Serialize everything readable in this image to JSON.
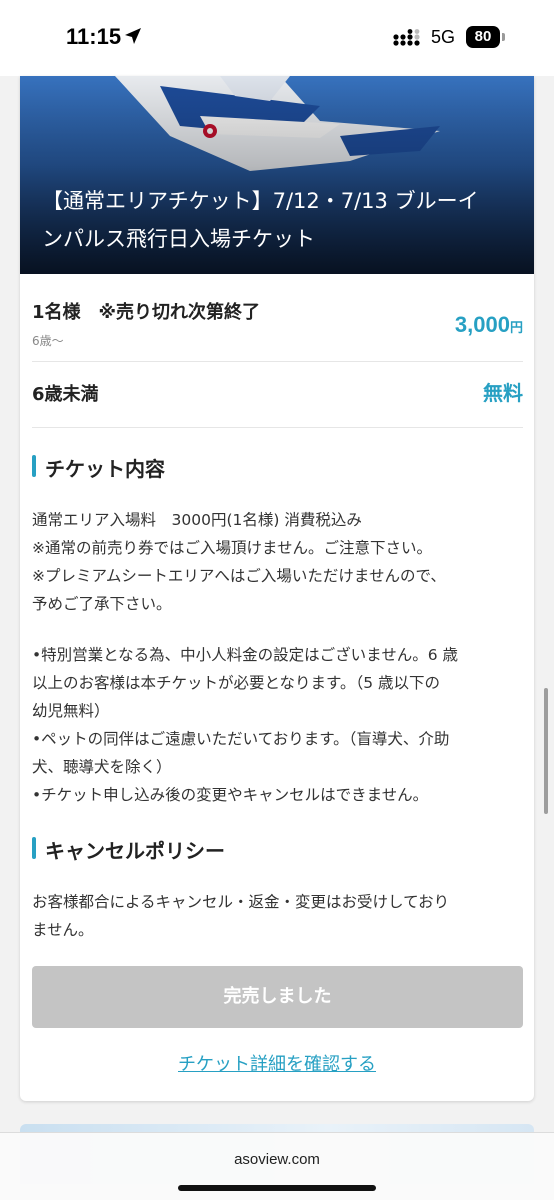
{
  "status_bar": {
    "time": "11:15",
    "network": "5G",
    "battery": "80"
  },
  "hero": {
    "title_line1": "【通常エリアチケット】7/12・7/13 ブルーイ",
    "title_line2": "ンパルス飛行日入場チケット"
  },
  "prices": [
    {
      "label": "1名様　※売り切れ次第終了",
      "sub": "6歳〜",
      "amount": "3,000",
      "unit": "円"
    },
    {
      "label": "6歳未満",
      "amount": "無料"
    }
  ],
  "ticket_section": {
    "heading": "チケット内容",
    "block1": [
      "通常エリア入場料　3000円(1名様) 消費税込み",
      "※通常の前売り券ではご入場頂けません。ご注意下さい。",
      "※プレミアムシートエリアへはご入場いただけませんので、",
      "予めご了承下さい。"
    ],
    "block2": [
      "•特別営業となる為、中小人料金の設定はございません。6 歳",
      "以上のお客様は本チケットが必要となります。（5 歳以下の",
      "幼児無料）",
      "•ペットの同伴はご遠慮いただいております。（盲導犬、介助",
      "犬、聴導犬を除く）",
      "•チケット申し込み後の変更やキャンセルはできません。"
    ]
  },
  "cancel_section": {
    "heading": "キャンセルポリシー",
    "lines": [
      "お客様都合によるキャンセル・返金・変更はお受けしており",
      "ません。"
    ]
  },
  "actions": {
    "soldout_label": "完売しました",
    "detail_link": "チケット詳細を確認する"
  },
  "browser": {
    "url": "asoview.com"
  },
  "colors": {
    "accent": "#27a0c3",
    "disabled_button": "#c4c4c4"
  }
}
